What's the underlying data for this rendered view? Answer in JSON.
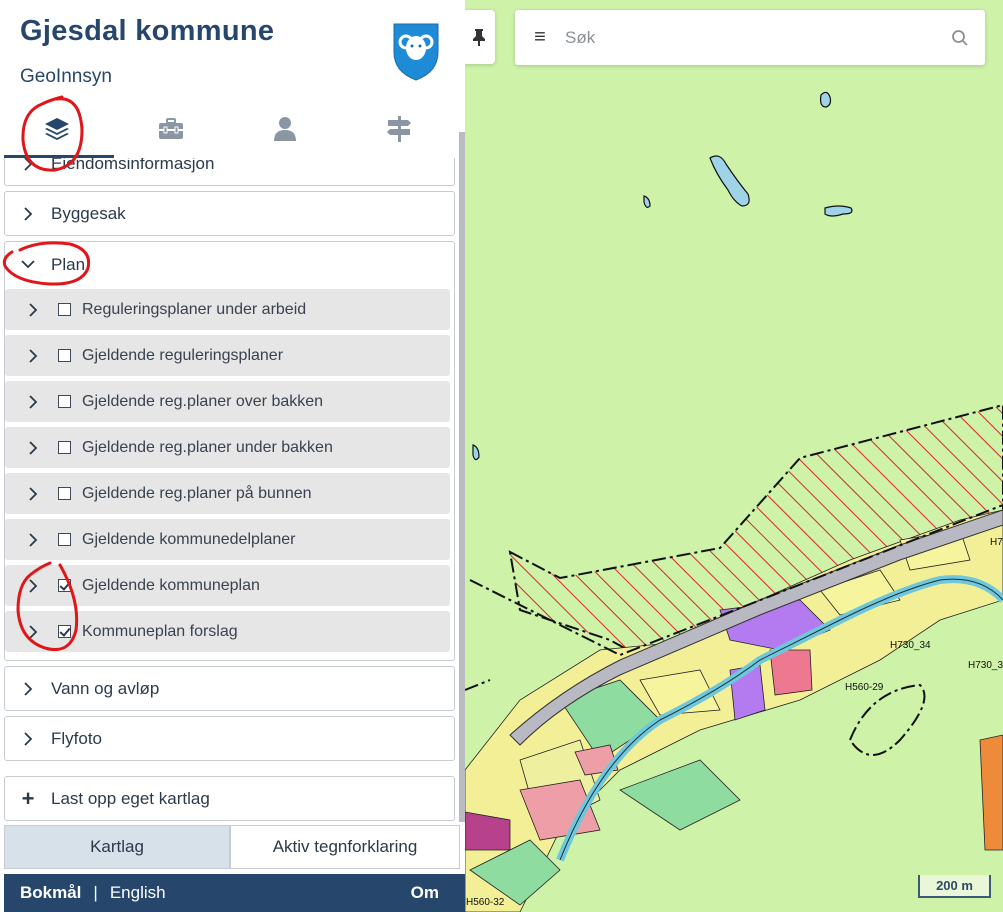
{
  "app": {
    "title": "Gjesdal kommune",
    "subtitle": "GeoInnsyn"
  },
  "tabs": [
    {
      "name": "layers-icon",
      "active": true
    },
    {
      "name": "toolbox-icon",
      "active": false
    },
    {
      "name": "user-icon",
      "active": false
    },
    {
      "name": "signpost-icon",
      "active": false
    }
  ],
  "groups": {
    "partial_label": "Eiendomsinformasjon",
    "byggesak": "Byggesak",
    "plan": "Plan",
    "vann": "Vann og avløp",
    "flyfoto": "Flyfoto",
    "upload": "Last opp eget kartlag"
  },
  "plan_layers": [
    {
      "label": "Reguleringsplaner under arbeid",
      "checked": false
    },
    {
      "label": "Gjeldende reguleringsplaner",
      "checked": false
    },
    {
      "label": "Gjeldende reg.planer over bakken",
      "checked": false
    },
    {
      "label": "Gjeldende reg.planer under bakken",
      "checked": false
    },
    {
      "label": "Gjeldende reg.planer på bunnen",
      "checked": false
    },
    {
      "label": "Gjeldende kommunedelplaner",
      "checked": false
    },
    {
      "label": "Gjeldende kommuneplan",
      "checked": true
    },
    {
      "label": "Kommuneplan forslag",
      "checked": true
    }
  ],
  "bottom_tabs": {
    "kartlag": "Kartlag",
    "tegnforklaring": "Aktiv tegnforklaring"
  },
  "footer": {
    "lang_active": "Bokmål",
    "lang_other": "English",
    "om": "Om"
  },
  "search": {
    "placeholder": "Søk"
  },
  "map": {
    "scale_label": "200 m",
    "labels": [
      "H730_34",
      "H730_3",
      "H560-29",
      "H560-32",
      "H7"
    ]
  },
  "colors": {
    "brand": "#26476b",
    "map_bg": "#cdf2a8",
    "annotation": "#e0161b"
  }
}
